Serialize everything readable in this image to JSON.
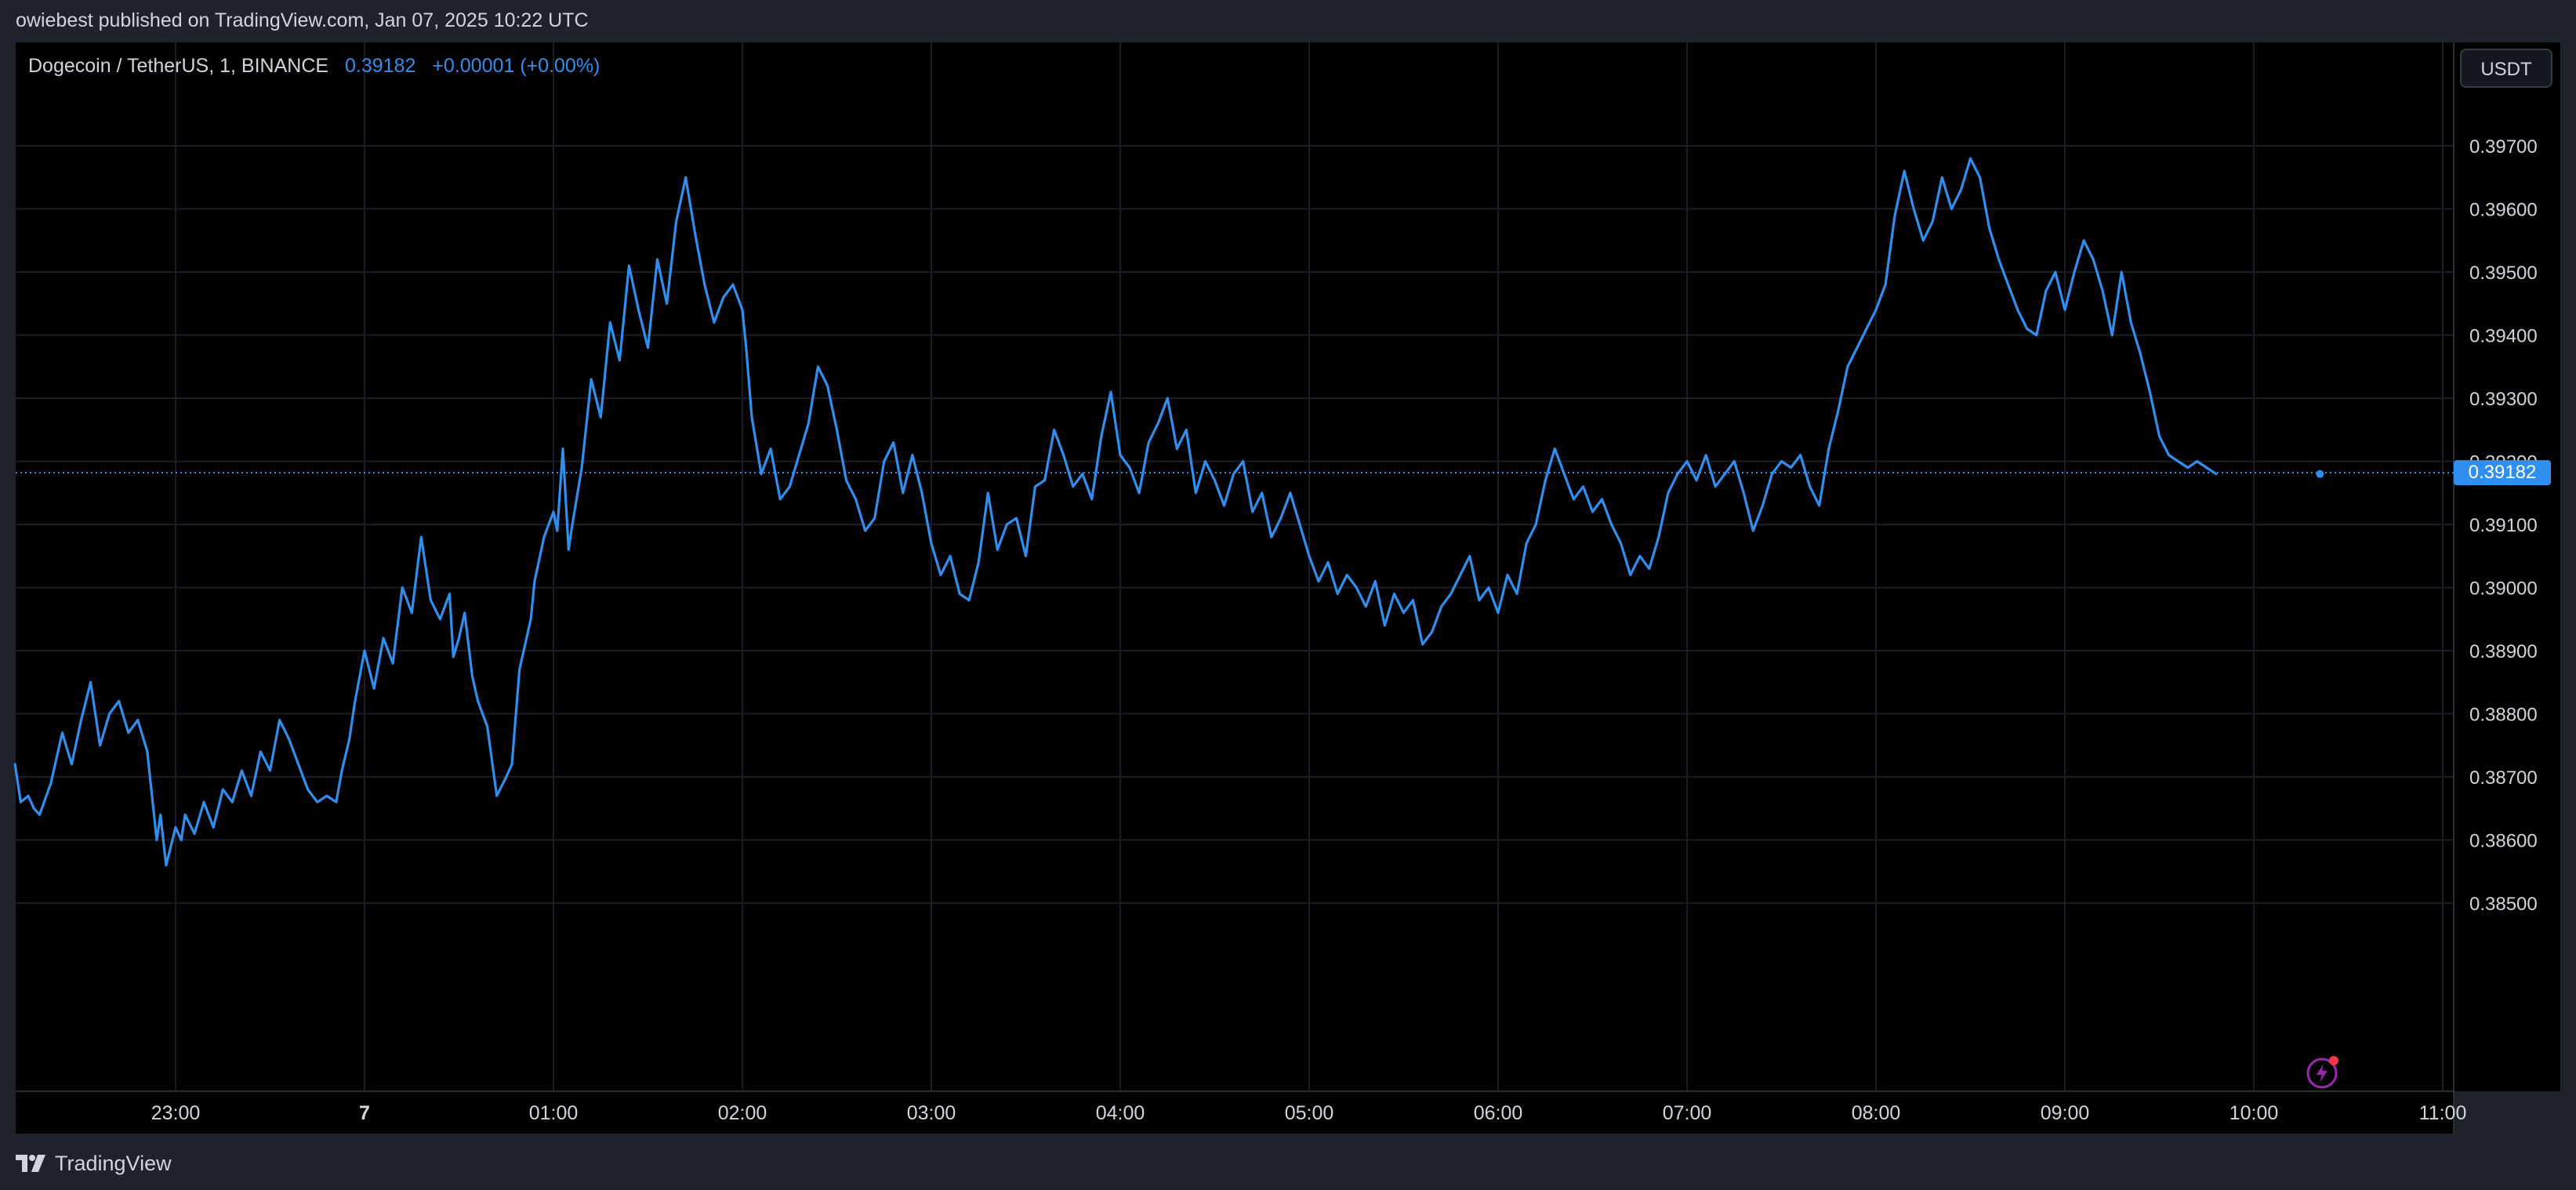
{
  "publisher_line": "owiebest published on TradingView.com, Jan 07, 2025 10:22 UTC",
  "legend": {
    "symbol": "Dogecoin / TetherUS, 1, BINANCE",
    "price": "0.39182",
    "change": "+0.00001 (+0.00%)"
  },
  "currency_button": "USDT",
  "last_price_label": "0.39182",
  "footer": {
    "brand": "TradingView",
    "logo_icon": "tradingview-logo-icon"
  },
  "icons": {
    "replay": "lightning-replay-icon"
  },
  "colors": {
    "background": "#000000",
    "frame": "#1e222d",
    "line": "#2f8fef",
    "grid": "#1a1d25",
    "text": "#d1d4dc"
  },
  "chart_data": {
    "type": "line",
    "title": "",
    "xlabel": "",
    "ylabel": "",
    "x_tick_labels": [
      "23:00",
      "7",
      "01:00",
      "02:00",
      "03:00",
      "04:00",
      "05:00",
      "06:00",
      "07:00",
      "08:00",
      "09:00",
      "10:00",
      "11:00"
    ],
    "x_tick_hours": [
      -1,
      0,
      1,
      2,
      3,
      4,
      5,
      6,
      7,
      8,
      9,
      10,
      11
    ],
    "y_ticks": [
      "0.38500",
      "0.38600",
      "0.38700",
      "0.38800",
      "0.38900",
      "0.39000",
      "0.39100",
      "0.39200",
      "0.39300",
      "0.39400",
      "0.39500",
      "0.39600",
      "0.39700"
    ],
    "ylim": [
      0.3847,
      0.3976
    ],
    "xlim_hours": [
      -1.85,
      11.2
    ],
    "last_price": 0.39182,
    "grid": true,
    "series": [
      {
        "x_hours": [
          -1.85,
          -1.82,
          -1.78,
          -1.75,
          -1.72,
          -1.66,
          -1.6,
          -1.55,
          -1.5,
          -1.45,
          -1.4,
          -1.35,
          -1.3,
          -1.25,
          -1.2,
          -1.15,
          -1.1,
          -1.08,
          -1.05,
          -1.0,
          -0.97,
          -0.95,
          -0.9,
          -0.85,
          -0.8,
          -0.75,
          -0.7,
          -0.65,
          -0.6,
          -0.55,
          -0.5,
          -0.45,
          -0.4,
          -0.35,
          -0.3,
          -0.25,
          -0.2,
          -0.15,
          -0.12,
          -0.08,
          -0.05,
          0.0,
          0.05,
          0.1,
          0.15,
          0.2,
          0.25,
          0.3,
          0.35,
          0.4,
          0.45,
          0.47,
          0.5,
          0.53,
          0.57,
          0.6,
          0.65,
          0.7,
          0.75,
          0.78,
          0.82,
          0.85,
          0.88,
          0.9,
          0.95,
          1.0,
          1.02,
          1.05,
          1.08,
          1.1,
          1.15,
          1.2,
          1.25,
          1.3,
          1.35,
          1.4,
          1.45,
          1.5,
          1.55,
          1.6,
          1.65,
          1.7,
          1.75,
          1.8,
          1.85,
          1.9,
          1.95,
          2.0,
          2.02,
          2.05,
          2.1,
          2.15,
          2.2,
          2.25,
          2.3,
          2.35,
          2.4,
          2.45,
          2.5,
          2.55,
          2.6,
          2.65,
          2.7,
          2.75,
          2.8,
          2.85,
          2.9,
          2.95,
          3.0,
          3.05,
          3.1,
          3.15,
          3.2,
          3.25,
          3.3,
          3.35,
          3.4,
          3.45,
          3.5,
          3.55,
          3.6,
          3.65,
          3.7,
          3.75,
          3.8,
          3.85,
          3.9,
          3.95,
          4.0,
          4.05,
          4.1,
          4.15,
          4.2,
          4.25,
          4.3,
          4.35,
          4.4,
          4.45,
          4.5,
          4.55,
          4.6,
          4.65,
          4.7,
          4.75,
          4.8,
          4.85,
          4.9,
          4.95,
          5.0,
          5.05,
          5.1,
          5.15,
          5.2,
          5.25,
          5.3,
          5.35,
          5.4,
          5.45,
          5.5,
          5.55,
          5.6,
          5.65,
          5.7,
          5.75,
          5.8,
          5.85,
          5.9,
          5.95,
          6.0,
          6.05,
          6.1,
          6.15,
          6.2,
          6.25,
          6.3,
          6.35,
          6.4,
          6.45,
          6.5,
          6.55,
          6.6,
          6.65,
          6.7,
          6.75,
          6.8,
          6.85,
          6.9,
          6.95,
          7.0,
          7.05,
          7.1,
          7.15,
          7.2,
          7.25,
          7.3,
          7.35,
          7.4,
          7.45,
          7.5,
          7.55,
          7.6,
          7.65,
          7.7,
          7.75,
          7.8,
          7.85,
          7.9,
          7.95,
          8.0,
          8.05,
          8.1,
          8.15,
          8.2,
          8.25,
          8.3,
          8.35,
          8.4,
          8.45,
          8.5,
          8.55,
          8.6,
          8.65,
          8.7,
          8.75,
          8.8,
          8.85,
          8.9,
          8.95,
          9.0,
          9.05,
          9.1,
          9.15,
          9.2,
          9.25,
          9.3,
          9.35,
          9.4,
          9.45,
          9.5,
          9.55,
          9.6,
          9.65,
          9.7,
          9.75,
          9.8,
          9.85,
          9.9,
          9.95,
          10.0,
          10.05,
          10.1,
          10.15,
          10.2,
          10.25,
          10.3,
          10.35
        ],
        "values": [
          0.3872,
          0.3866,
          0.3867,
          0.3865,
          0.3864,
          0.3869,
          0.3877,
          0.3872,
          0.3879,
          0.3885,
          0.3875,
          0.388,
          0.3882,
          0.3877,
          0.3879,
          0.3874,
          0.386,
          0.3864,
          0.3856,
          0.3862,
          0.386,
          0.3864,
          0.3861,
          0.3866,
          0.3862,
          0.3868,
          0.3866,
          0.3871,
          0.3867,
          0.3874,
          0.3871,
          0.3879,
          0.3876,
          0.3872,
          0.3868,
          0.3866,
          0.3867,
          0.3866,
          0.3871,
          0.3876,
          0.3882,
          0.389,
          0.3884,
          0.3892,
          0.3888,
          0.39,
          0.3896,
          0.3908,
          0.3898,
          0.3895,
          0.3899,
          0.3889,
          0.3892,
          0.3896,
          0.3886,
          0.3882,
          0.3878,
          0.3867,
          0.387,
          0.3872,
          0.3887,
          0.3891,
          0.3895,
          0.3901,
          0.3908,
          0.3912,
          0.3909,
          0.3922,
          0.3906,
          0.391,
          0.3919,
          0.3933,
          0.3927,
          0.3942,
          0.3936,
          0.3951,
          0.3944,
          0.3938,
          0.3952,
          0.3945,
          0.3958,
          0.3965,
          0.3956,
          0.3948,
          0.3942,
          0.3946,
          0.3948,
          0.3944,
          0.3938,
          0.3927,
          0.3918,
          0.3922,
          0.3914,
          0.3916,
          0.3921,
          0.3926,
          0.3935,
          0.3932,
          0.3925,
          0.3917,
          0.3914,
          0.3909,
          0.3911,
          0.392,
          0.3923,
          0.3915,
          0.3921,
          0.3915,
          0.3907,
          0.3902,
          0.3905,
          0.3899,
          0.3898,
          0.3904,
          0.3915,
          0.3906,
          0.391,
          0.3911,
          0.3905,
          0.3916,
          0.3917,
          0.3925,
          0.3921,
          0.3916,
          0.3918,
          0.3914,
          0.3924,
          0.3931,
          0.3921,
          0.3919,
          0.3915,
          0.3923,
          0.3926,
          0.393,
          0.3922,
          0.3925,
          0.3915,
          0.392,
          0.3917,
          0.3913,
          0.3918,
          0.392,
          0.3912,
          0.3915,
          0.3908,
          0.3911,
          0.3915,
          0.391,
          0.3905,
          0.3901,
          0.3904,
          0.3899,
          0.3902,
          0.39,
          0.3897,
          0.3901,
          0.3894,
          0.3899,
          0.3896,
          0.3898,
          0.3891,
          0.3893,
          0.3897,
          0.3899,
          0.3902,
          0.3905,
          0.3898,
          0.39,
          0.3896,
          0.3902,
          0.3899,
          0.3907,
          0.391,
          0.3917,
          0.3922,
          0.3918,
          0.3914,
          0.3916,
          0.3912,
          0.3914,
          0.391,
          0.3907,
          0.3902,
          0.3905,
          0.3903,
          0.3908,
          0.3915,
          0.3918,
          0.392,
          0.3917,
          0.3921,
          0.3916,
          0.3918,
          0.392,
          0.3915,
          0.3909,
          0.3913,
          0.3918,
          0.392,
          0.3919,
          0.3921,
          0.3916,
          0.3913,
          0.3922,
          0.3928,
          0.3935,
          0.3938,
          0.3941,
          0.3944,
          0.3948,
          0.3959,
          0.3966,
          0.396,
          0.3955,
          0.3958,
          0.3965,
          0.396,
          0.3963,
          0.3968,
          0.3965,
          0.3957,
          0.3952,
          0.3948,
          0.3944,
          0.3941,
          0.394,
          0.3947,
          0.395,
          0.3944,
          0.395,
          0.3955,
          0.3952,
          0.3947,
          0.394,
          0.395,
          0.3942,
          0.3937,
          0.3931,
          0.3924,
          0.3921,
          0.392,
          0.3919,
          0.392,
          0.3919,
          0.3918
        ]
      }
    ]
  }
}
